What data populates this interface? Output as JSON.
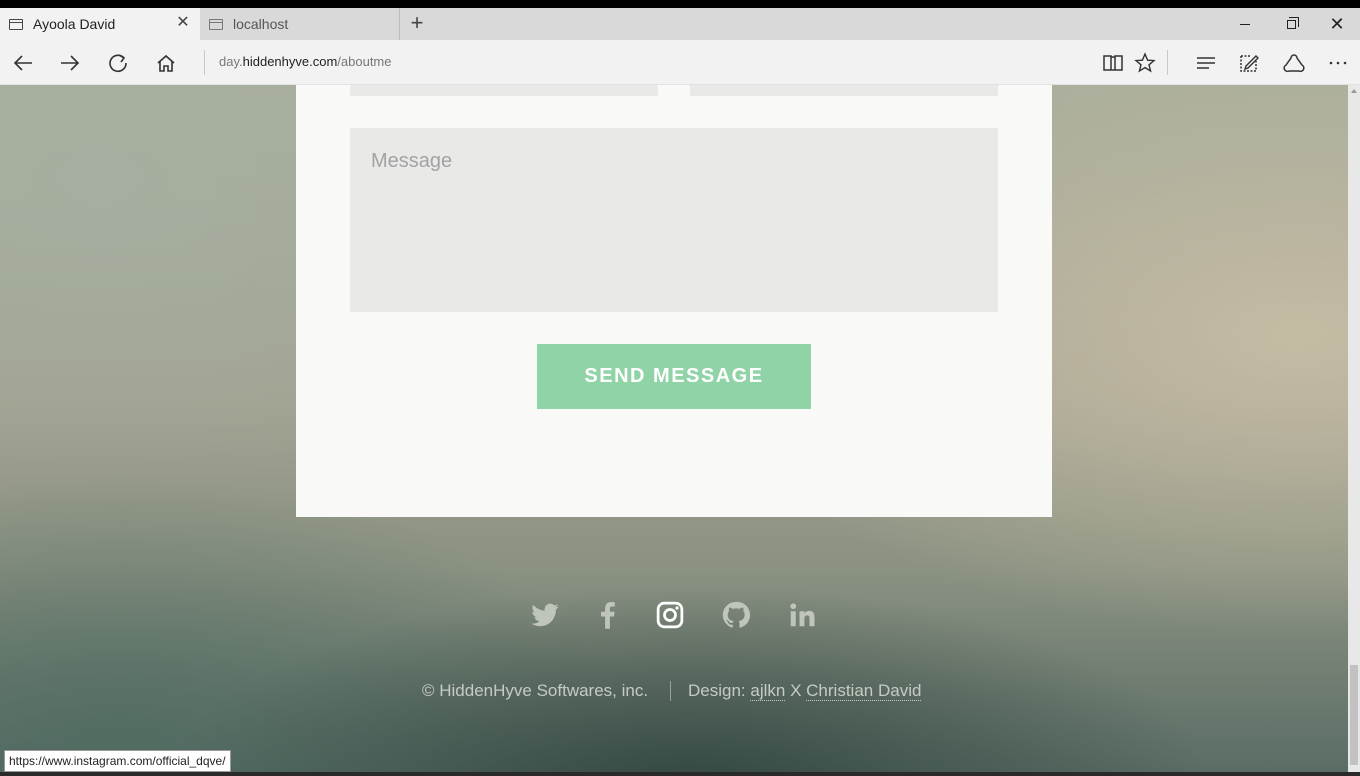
{
  "browser": {
    "tabs": [
      {
        "title": "Ayoola David",
        "active": true
      },
      {
        "title": "localhost",
        "active": false
      }
    ],
    "tab_close": "✕",
    "new_tab": "+",
    "address": {
      "prefix": "day.",
      "host": "hiddenhyve.com",
      "path": "/aboutme"
    },
    "status_url": "https://www.instagram.com/official_dqve/",
    "icons": {
      "back": "back-arrow-icon",
      "forward": "forward-arrow-icon",
      "refresh": "refresh-icon",
      "home": "home-icon",
      "reading_view": "book-icon",
      "favorite": "star-icon",
      "hub": "hub-icon",
      "web_note": "web-note-icon",
      "share": "share-icon",
      "more": "more-icon"
    }
  },
  "contact_form": {
    "message_placeholder": "Message",
    "message_value": "",
    "send_label": "SEND MESSAGE",
    "send_color": "#8fd3a7"
  },
  "footer": {
    "social": [
      "twitter",
      "facebook",
      "instagram",
      "github",
      "linkedin"
    ],
    "highlighted": "instagram",
    "copyright": "© HiddenHyve Softwares, inc.",
    "design_label": "Design:",
    "designer_1": "ajlkn",
    "separator_x": "X",
    "designer_2": "Christian David"
  }
}
